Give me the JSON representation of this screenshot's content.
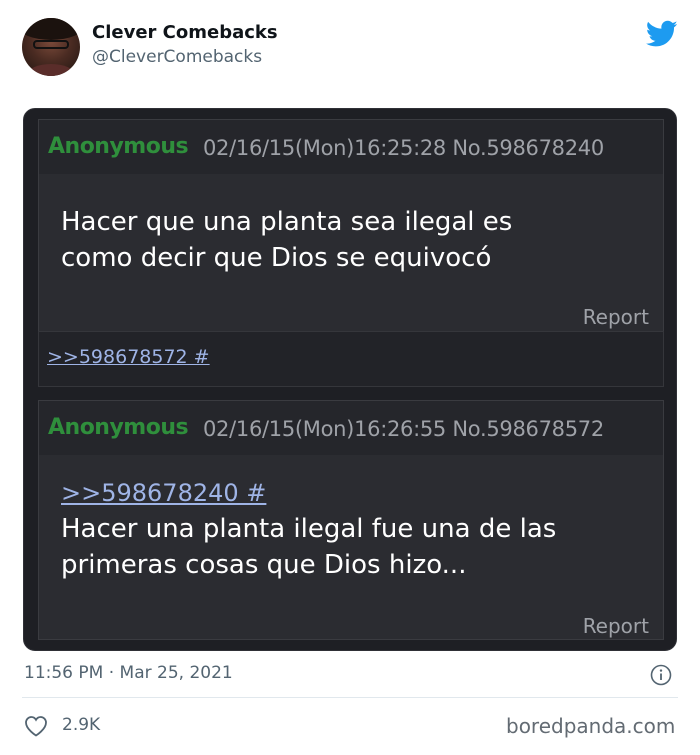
{
  "tweet": {
    "display_name": "Clever Comebacks",
    "handle": "@CleverComebacks",
    "timestamp": "11:56 PM · Mar 25, 2021",
    "likes": "2.9K",
    "icons": {
      "brand": "twitter-bird-icon",
      "info": "info-icon",
      "like": "heart-icon"
    },
    "colors": {
      "brand": "#1d9bf0",
      "muted": "#536471"
    }
  },
  "screenshot": {
    "post1": {
      "poster": "Anonymous",
      "meta": "02/16/15(Mon)16:25:28 No.598678240",
      "body_line1": "Hacer que una planta sea ilegal es",
      "body_line2": "como decir que Dios se equivocó",
      "report": "Report"
    },
    "backlink": ">>598678572 #",
    "post2": {
      "poster": "Anonymous",
      "meta": "02/16/15(Mon)16:26:55 No.598678572",
      "quote": ">>598678240 #",
      "body_line1": "Hacer una planta ilegal fue una de las",
      "body_line2": "primeras cosas que Dios hizo...",
      "report": "Report"
    },
    "colors": {
      "poster_name": "#2f8f3c",
      "link": "#9fb4e6",
      "background": "#1e1f24"
    }
  },
  "watermark": "boredpanda.com"
}
